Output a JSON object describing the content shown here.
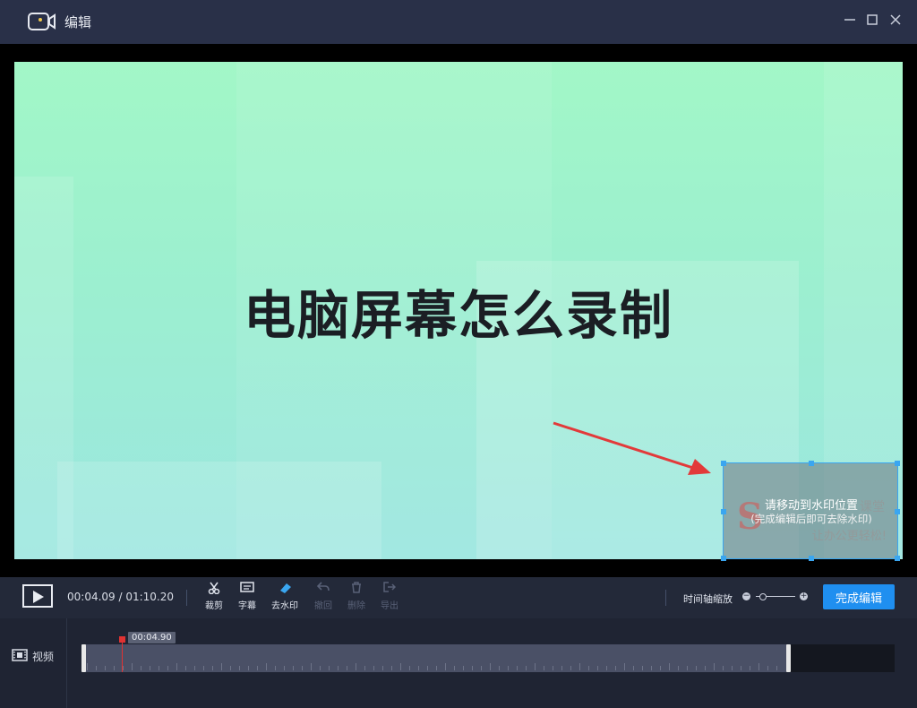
{
  "window": {
    "title": "编辑"
  },
  "video": {
    "title": "电脑屏幕怎么录制",
    "watermark_hint_line1": "请移动到水印位置",
    "watermark_hint_line2": "(完成编辑后即可去除水印)",
    "watermark_brand_sub": "让办公更轻松!",
    "watermark_brand_name": "课堂"
  },
  "toolbar": {
    "time_display": "00:04.09 / 01:10.20",
    "tools": [
      {
        "label": "裁剪",
        "icon": "scissors-icon",
        "enabled": true
      },
      {
        "label": "字幕",
        "icon": "subtitle-icon",
        "enabled": true
      },
      {
        "label": "去水印",
        "icon": "eraser-icon",
        "enabled": true
      },
      {
        "label": "撤回",
        "icon": "undo-icon",
        "enabled": false
      },
      {
        "label": "删除",
        "icon": "trash-icon",
        "enabled": false
      },
      {
        "label": "导出",
        "icon": "export-icon",
        "enabled": false
      }
    ],
    "zoom_label": "时间轴缩放",
    "zoom_level": 0.15,
    "finish_label": "完成编辑"
  },
  "timeline": {
    "track_label": "视频",
    "playhead_time": "00:04.90"
  },
  "colors": {
    "accent": "#1f8ff0",
    "playhead": "#e03232",
    "titlebar": "#293048"
  }
}
